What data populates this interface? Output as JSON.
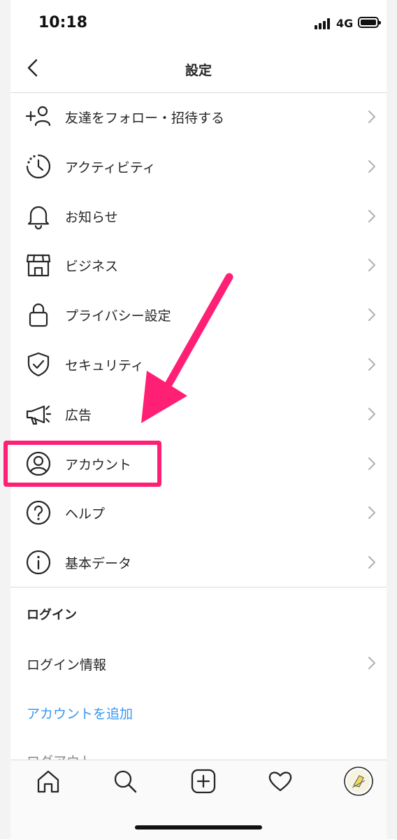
{
  "status_bar": {
    "time": "10:18",
    "network": "4G"
  },
  "header": {
    "title": "設定"
  },
  "menu": [
    {
      "icon": "add-person-icon",
      "label": "友達をフォロー・招待する"
    },
    {
      "icon": "activity-clock-icon",
      "label": "アクティビティ"
    },
    {
      "icon": "bell-icon",
      "label": "お知らせ"
    },
    {
      "icon": "shop-icon",
      "label": "ビジネス"
    },
    {
      "icon": "lock-icon",
      "label": "プライバシー設定"
    },
    {
      "icon": "shield-check-icon",
      "label": "セキュリティ"
    },
    {
      "icon": "megaphone-icon",
      "label": "広告"
    },
    {
      "icon": "person-circle-icon",
      "label": "アカウント"
    },
    {
      "icon": "help-circle-icon",
      "label": "ヘルプ"
    },
    {
      "icon": "info-circle-icon",
      "label": "基本データ"
    }
  ],
  "login_section": {
    "header": "ログイン",
    "login_info": "ログイン情報",
    "add_account": "アカウントを追加",
    "logout_partial": "ログアウト"
  },
  "tab_bar": {
    "items": [
      {
        "icon": "home-icon"
      },
      {
        "icon": "search-icon"
      },
      {
        "icon": "new-post-icon"
      },
      {
        "icon": "heart-icon"
      },
      {
        "icon": "profile-avatar-icon"
      }
    ]
  },
  "annotation": {
    "highlight_color": "#ff1f74",
    "highlighted_item": "アカウント"
  }
}
